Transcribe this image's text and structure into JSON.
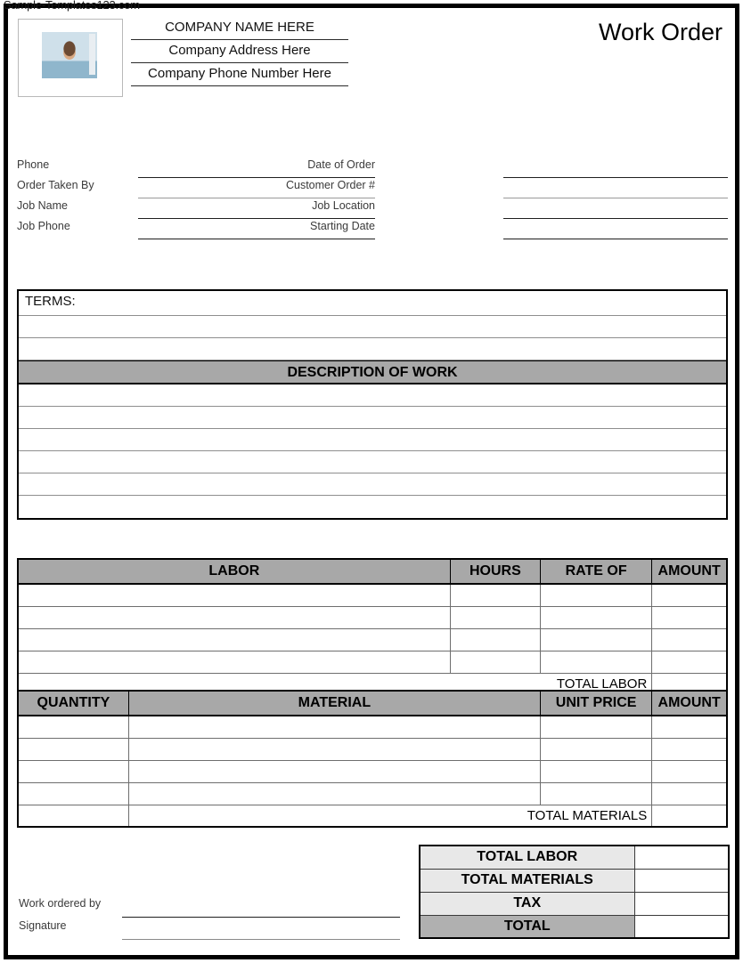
{
  "watermark": "Sample-Templates123.com",
  "header": {
    "logo_alt": "company-photo-placeholder",
    "company_name": "COMPANY NAME HERE",
    "company_address": "Company Address Here",
    "company_phone": "Company Phone Number Here",
    "doc_title": "Work Order"
  },
  "form_fields": {
    "left": [
      {
        "label": "Phone",
        "value": ""
      },
      {
        "label": "Order Taken By",
        "value": ""
      },
      {
        "label": "Job Name",
        "value": ""
      },
      {
        "label": "Job Phone",
        "value": ""
      }
    ],
    "right": [
      {
        "label": "Date of Order",
        "value": ""
      },
      {
        "label": "Customer Order #",
        "value": ""
      },
      {
        "label": "Job Location",
        "value": ""
      },
      {
        "label": "Starting Date",
        "value": ""
      }
    ]
  },
  "terms": {
    "label": "TERMS:",
    "rows": [
      "",
      "",
      ""
    ]
  },
  "description_of_work": {
    "header": "DESCRIPTION OF WORK",
    "rows": [
      "",
      "",
      "",
      "",
      "",
      ""
    ]
  },
  "labor_table": {
    "columns": [
      "LABOR",
      "HOURS",
      "RATE OF",
      "AMOUNT"
    ],
    "rows": [
      [
        "",
        "",
        "",
        ""
      ],
      [
        "",
        "",
        "",
        ""
      ],
      [
        "",
        "",
        "",
        ""
      ],
      [
        "",
        "",
        "",
        ""
      ]
    ],
    "total_label": "TOTAL LABOR",
    "total_value": ""
  },
  "material_table": {
    "columns": [
      "QUANTITY",
      "MATERIAL",
      "UNIT PRICE",
      "AMOUNT"
    ],
    "rows": [
      [
        "",
        "",
        "",
        ""
      ],
      [
        "",
        "",
        "",
        ""
      ],
      [
        "",
        "",
        "",
        ""
      ],
      [
        "",
        "",
        "",
        ""
      ]
    ],
    "total_label": "TOTAL MATERIALS",
    "total_value": ""
  },
  "summary": {
    "rows": [
      {
        "label": "TOTAL LABOR",
        "value": ""
      },
      {
        "label": "TOTAL MATERIALS",
        "value": ""
      },
      {
        "label": "TAX",
        "value": ""
      },
      {
        "label": "TOTAL",
        "value": ""
      }
    ]
  },
  "signature": {
    "rows": [
      {
        "label": "Work ordered by",
        "value": ""
      },
      {
        "label": "Signature",
        "value": ""
      }
    ]
  },
  "colors": {
    "header_gray": "#a8a8a8",
    "summary_label_gray": "#e8e8e8",
    "summary_total_gray": "#b0b0b0",
    "border_black": "#000000"
  }
}
